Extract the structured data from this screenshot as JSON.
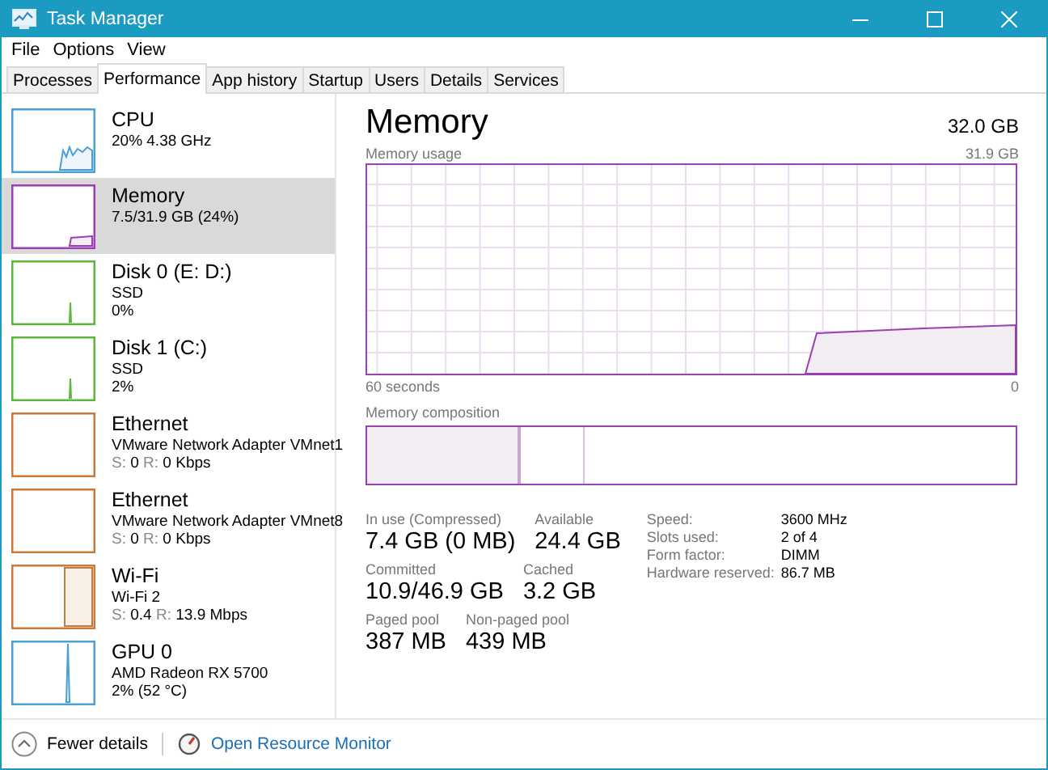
{
  "window": {
    "title": "Task Manager"
  },
  "menu": [
    "File",
    "Options",
    "View"
  ],
  "tabs": [
    {
      "label": "Processes",
      "selected": false
    },
    {
      "label": "Performance",
      "selected": true
    },
    {
      "label": "App history",
      "selected": false
    },
    {
      "label": "Startup",
      "selected": false
    },
    {
      "label": "Users",
      "selected": false
    },
    {
      "label": "Details",
      "selected": false
    },
    {
      "label": "Services",
      "selected": false
    }
  ],
  "sidebar": {
    "items": [
      {
        "kind": "cpu",
        "title": "CPU",
        "lines": [
          "20%  4.38 GHz"
        ],
        "color": "#4a9fd4",
        "selected": false
      },
      {
        "kind": "memory",
        "title": "Memory",
        "lines": [
          "7.5/31.9 GB (24%)"
        ],
        "color": "#9b3fb5",
        "selected": true
      },
      {
        "kind": "disk",
        "title": "Disk 0 (E: D:)",
        "lines": [
          "SSD",
          "0%"
        ],
        "color": "#5cb83c",
        "selected": false
      },
      {
        "kind": "disk",
        "title": "Disk 1 (C:)",
        "lines": [
          "SSD",
          "2%"
        ],
        "color": "#5cb83c",
        "selected": false
      },
      {
        "kind": "network",
        "title": "Ethernet",
        "lines": [
          "VMware Network Adapter VMnet1"
        ],
        "rates": [
          {
            "label": "S:",
            "value": "0"
          },
          {
            "label": "R:",
            "value": "0 Kbps"
          }
        ],
        "color": "#c77a3a",
        "selected": false
      },
      {
        "kind": "network",
        "title": "Ethernet",
        "lines": [
          "VMware Network Adapter VMnet8"
        ],
        "rates": [
          {
            "label": "S:",
            "value": "0"
          },
          {
            "label": "R:",
            "value": "0 Kbps"
          }
        ],
        "color": "#c77a3a",
        "selected": false
      },
      {
        "kind": "wifi",
        "title": "Wi-Fi",
        "lines": [
          "Wi-Fi 2"
        ],
        "rates": [
          {
            "label": "S:",
            "value": "0.4"
          },
          {
            "label": "R:",
            "value": "13.9 Mbps"
          }
        ],
        "color": "#c77a3a",
        "selected": false
      },
      {
        "kind": "gpu",
        "title": "GPU 0",
        "lines": [
          "AMD Radeon RX 5700",
          "2%  (52 °C)"
        ],
        "color": "#4a9fd4",
        "selected": false
      }
    ]
  },
  "main": {
    "title": "Memory",
    "total": "32.0 GB",
    "usage_graph": {
      "label": "Memory usage",
      "max": "31.9 GB",
      "time_start": "60 seconds",
      "time_end": "0"
    },
    "composition": {
      "label": "Memory composition"
    },
    "stats": [
      [
        {
          "label": "In use (Compressed)",
          "value": "7.4 GB (0 MB)"
        },
        {
          "label": "Available",
          "value": "24.4 GB"
        }
      ],
      [
        {
          "label": "Committed",
          "value": "10.9/46.9 GB"
        },
        {
          "label": "Cached",
          "value": "3.2 GB"
        }
      ],
      [
        {
          "label": "Paged pool",
          "value": "387 MB"
        },
        {
          "label": "Non-paged pool",
          "value": "439 MB"
        }
      ]
    ],
    "details": [
      {
        "label": "Speed:",
        "value": "3600 MHz"
      },
      {
        "label": "Slots used:",
        "value": "2 of 4"
      },
      {
        "label": "Form factor:",
        "value": "DIMM"
      },
      {
        "label": "Hardware reserved:",
        "value": "86.7 MB"
      }
    ]
  },
  "footer": {
    "fewer_details": "Fewer details",
    "resource_monitor": "Open Resource Monitor"
  }
}
